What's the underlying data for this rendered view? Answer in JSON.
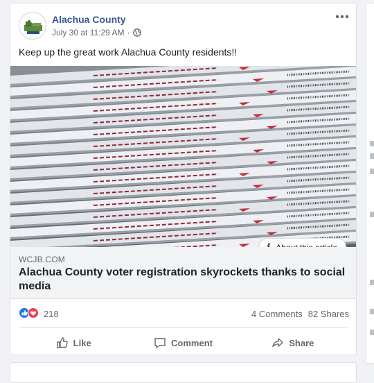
{
  "post": {
    "page_name": "Alachua County",
    "timestamp": "July 30 at 11:29 AM",
    "separator": "·",
    "privacy_icon": "globe-icon",
    "more_icon": "more-options-icon",
    "text": "Keep up the great work Alachua County residents!!"
  },
  "article": {
    "about_label": "About this article",
    "domain": "WCJB.COM",
    "headline": "Alachua County voter registration skyrockets thanks to social media"
  },
  "engagement": {
    "reaction_icons": [
      "like-reaction-icon",
      "love-reaction-icon"
    ],
    "reaction_count": "218",
    "comments": "4 Comments",
    "shares": "82 Shares"
  },
  "actions": {
    "like": "Like",
    "comment": "Comment",
    "share": "Share"
  },
  "colors": {
    "link": "#385898",
    "like_blue": "#1877f2",
    "love_red": "#f33e58",
    "card_gray": "#f2f3f5"
  }
}
